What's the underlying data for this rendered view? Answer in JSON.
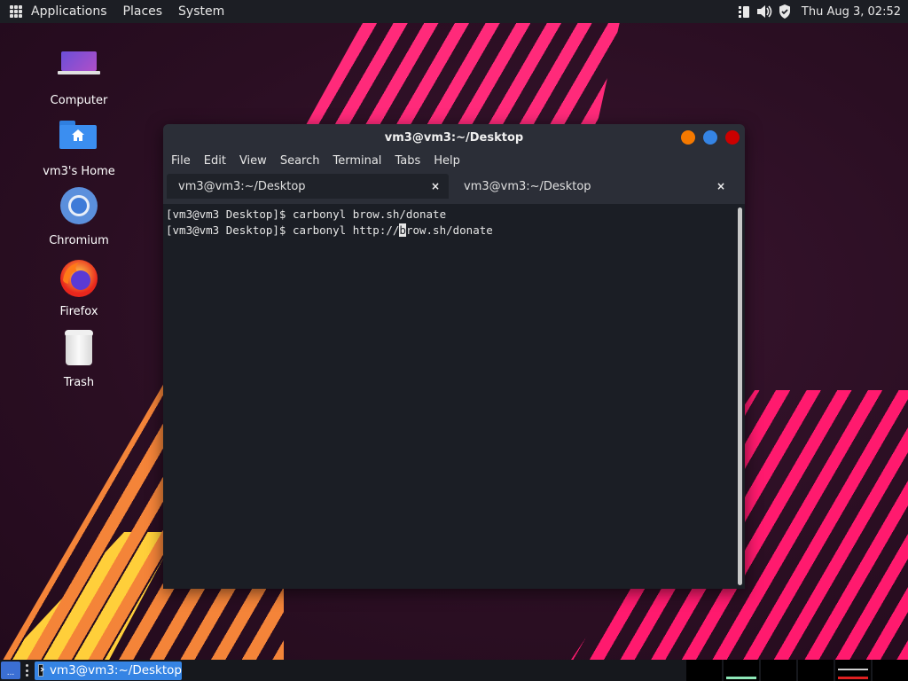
{
  "top_panel": {
    "menus": [
      "Applications",
      "Places",
      "System"
    ],
    "clock": "Thu Aug  3, 02:52"
  },
  "desktop_icons": [
    {
      "label": "Computer",
      "icon": "computer-icon"
    },
    {
      "label": "vm3's Home",
      "icon": "home-folder-icon"
    },
    {
      "label": "Chromium",
      "icon": "chromium-icon"
    },
    {
      "label": "Firefox",
      "icon": "firefox-icon"
    },
    {
      "label": "Trash",
      "icon": "trash-icon"
    }
  ],
  "terminal": {
    "title": "vm3@vm3:~/Desktop",
    "window_buttons": {
      "minimize": "#f57900",
      "maximize": "#3584e4",
      "close": "#cc0000"
    },
    "menu": [
      "File",
      "Edit",
      "View",
      "Search",
      "Terminal",
      "Tabs",
      "Help"
    ],
    "tabs": [
      {
        "label": "vm3@vm3:~/Desktop",
        "close": "×",
        "active": true
      },
      {
        "label": "vm3@vm3:~/Desktop",
        "close": "×",
        "active": false
      }
    ],
    "lines": [
      {
        "prompt": "[vm3@vm3 Desktop]$ ",
        "command": "carbonyl brow.sh/donate"
      },
      {
        "prompt": "[vm3@vm3 Desktop]$ ",
        "command_before_cursor": "carbonyl http://",
        "cursor_char": "b",
        "command_after_cursor": "row.sh/donate"
      }
    ]
  },
  "bottom_panel": {
    "show_desktop_label": "...",
    "task_label": "vm3@vm3:~/Desktop",
    "workspace_count": 6
  }
}
